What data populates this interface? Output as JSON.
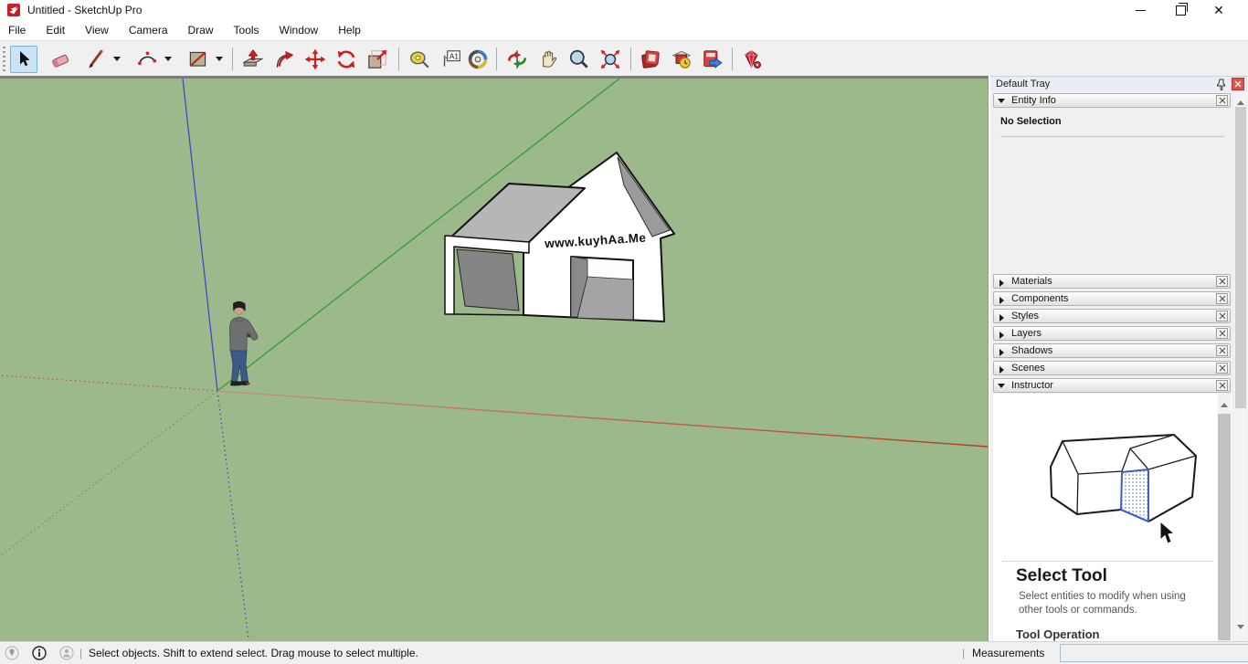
{
  "window": {
    "title": "Untitled - SketchUp Pro"
  },
  "menu": {
    "items": [
      "File",
      "Edit",
      "View",
      "Camera",
      "Draw",
      "Tools",
      "Window",
      "Help"
    ]
  },
  "toolbar": {
    "text_tool_label": "A1",
    "tools": [
      "select",
      "eraser",
      "line",
      "2-point-arc",
      "rectangle",
      "push-pull",
      "follow-me",
      "move",
      "rotate",
      "scale",
      "tape-measure",
      "text",
      "paint-bucket",
      "orbit",
      "pan",
      "zoom",
      "zoom-extents",
      "send-to-layout",
      "3d-warehouse",
      "export",
      "extension-store"
    ]
  },
  "viewport": {
    "watermark": "www.kuyhAa.Me",
    "colors": {
      "background": "#9cb98b",
      "axis_red": "#c0392b",
      "axis_green": "#2f9e2f",
      "axis_blue": "#3b3bcf"
    }
  },
  "tray": {
    "title": "Default Tray",
    "sections": [
      {
        "label": "Entity Info",
        "expanded": true
      },
      {
        "label": "Materials",
        "expanded": false
      },
      {
        "label": "Components",
        "expanded": false
      },
      {
        "label": "Styles",
        "expanded": false
      },
      {
        "label": "Layers",
        "expanded": false
      },
      {
        "label": "Shadows",
        "expanded": false
      },
      {
        "label": "Scenes",
        "expanded": false
      },
      {
        "label": "Instructor",
        "expanded": true
      }
    ],
    "entity_info": {
      "message": "No Selection"
    },
    "instructor": {
      "heading": "Select Tool",
      "description": "Select entities to modify when using other tools or commands.",
      "subheading": "Tool Operation"
    }
  },
  "status_bar": {
    "hint": "Select objects. Shift to extend select. Drag mouse to select multiple.",
    "measurements_label": "Measurements",
    "measurements_value": ""
  }
}
